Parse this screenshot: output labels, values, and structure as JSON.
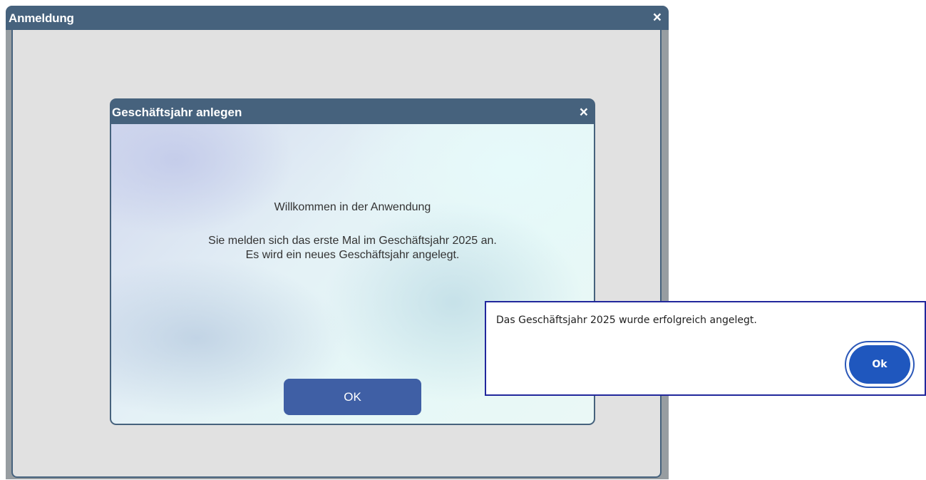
{
  "outer_window": {
    "title": "Anmeldung",
    "close_glyph": "×",
    "close_icon": "close-icon"
  },
  "dialog": {
    "title": "Geschäftsjahr anlegen",
    "close_glyph": "×",
    "close_icon": "close-icon",
    "welcome_heading": "Willkommen in der Anwendung",
    "message_line1": "Sie melden sich das erste Mal im Geschäftsjahr 2025 an.",
    "message_line2": "Es wird ein neues Geschäftsjahr angelegt.",
    "ok_label": "OK"
  },
  "notification": {
    "message": "Das Geschäftsjahr 2025 wurde erfolgreich angelegt.",
    "ok_label": "Ok"
  },
  "colors": {
    "titlebar": "#46627d",
    "dialog_ok_button": "#3f5fa5",
    "notification_border": "#21279c",
    "notification_ok_button": "#1f57be"
  }
}
